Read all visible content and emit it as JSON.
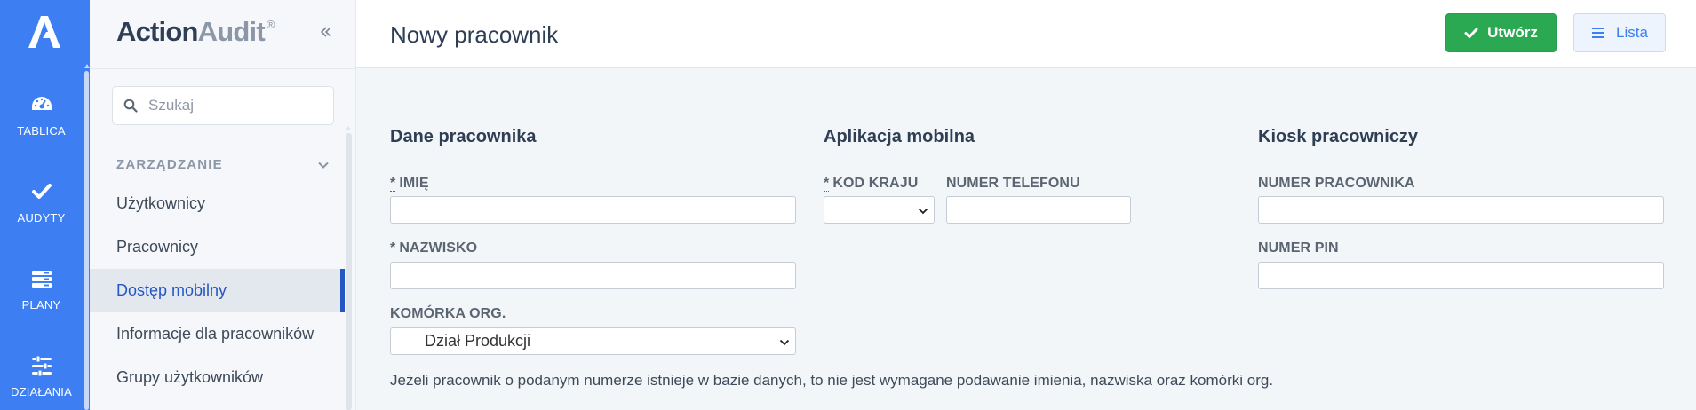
{
  "app": {
    "brand_part1": "Action",
    "brand_part2": "Audit",
    "brand_reg": "®",
    "accent_color": "#3d7ff2",
    "success_color": "#2aa952"
  },
  "rail": {
    "items": [
      {
        "label": "TABLICA",
        "icon": "dashboard-icon"
      },
      {
        "label": "AUDYTY",
        "icon": "check-icon"
      },
      {
        "label": "PLANY",
        "icon": "plans-icon"
      },
      {
        "label": "DZIAŁANIA",
        "icon": "sliders-icon"
      }
    ]
  },
  "sidebar": {
    "search_placeholder": "Szukaj",
    "section_label": "ZARZĄDZANIE",
    "items": [
      {
        "label": "Użytkownicy",
        "active": false
      },
      {
        "label": "Pracownicy",
        "active": false
      },
      {
        "label": "Dostęp mobilny",
        "active": true
      },
      {
        "label": "Informacje dla pracowników",
        "active": false
      },
      {
        "label": "Grupy użytkowników",
        "active": false
      }
    ]
  },
  "header": {
    "title": "Nowy pracownik",
    "create_label": "Utwórz",
    "list_label": "Lista"
  },
  "form": {
    "employee": {
      "title": "Dane pracownika",
      "first_name_label": "IMIĘ",
      "first_name_value": "",
      "last_name_label": "NAZWISKO",
      "last_name_value": "",
      "org_unit_label": "KOMÓRKA ORG.",
      "org_unit_value": "Dział Produkcji"
    },
    "mobile": {
      "title": "Aplikacja mobilna",
      "country_code_label": "KOD KRAJU",
      "country_code_value": "",
      "phone_label": "NUMER TELEFONU",
      "phone_value": ""
    },
    "kiosk": {
      "title": "Kiosk pracowniczy",
      "employee_number_label": "NUMER PRACOWNIKA",
      "employee_number_value": "",
      "pin_label": "NUMER PIN",
      "pin_value": ""
    },
    "required_mark": "*",
    "help_text": "Jeżeli pracownik o podanym numerze istnieje w bazie danych, to nie jest wymagane podawanie imienia, nazwiska oraz komórki org."
  }
}
